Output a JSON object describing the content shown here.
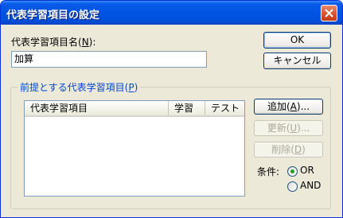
{
  "window": {
    "title": "代表学習項目の設定"
  },
  "name_field": {
    "label_prefix": "代表学習項目名(",
    "label_key": "N",
    "label_suffix": "):",
    "value": "加算"
  },
  "buttons": {
    "ok": "OK",
    "cancel": "キャンセル",
    "add": {
      "prefix": "追加(",
      "key": "A",
      "suffix": ")..."
    },
    "update": {
      "prefix": "更新(",
      "key": "U",
      "suffix": ")..."
    },
    "delete": {
      "prefix": "削除(",
      "key": "D",
      "suffix": ")"
    }
  },
  "group": {
    "title_prefix": "前提とする代表学習項目(",
    "title_key": "P",
    "title_suffix": ")"
  },
  "list": {
    "columns": [
      "代表学習項目",
      "学習",
      "テスト"
    ],
    "rows": []
  },
  "condition": {
    "label": "条件:",
    "options": [
      {
        "label": "OR",
        "selected": true
      },
      {
        "label": "AND",
        "selected": false
      }
    ]
  },
  "colors": {
    "title_bar": "#0054e3",
    "dialog_bg": "#ece9d8",
    "group_title": "#0046d5",
    "close_button": "#d64f2a"
  }
}
